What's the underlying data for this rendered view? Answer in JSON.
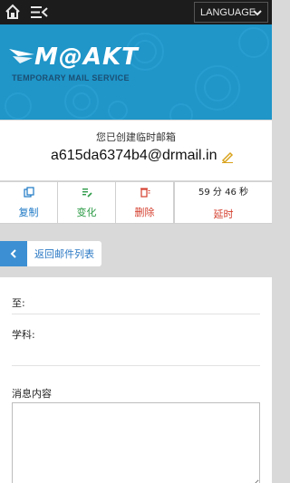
{
  "topbar": {
    "language_label": "LANGUAGE",
    "icons": [
      "home-icon",
      "menu-icon",
      "chevron-down-icon"
    ]
  },
  "header": {
    "logo_text": "M@AKT",
    "logo_subtitle": "TEMPORARY MAIL SERVICE",
    "background_color": "#1f95c8"
  },
  "email_card": {
    "caption": "您已创建临时邮箱",
    "address": "a615da6374b4@drmail.in",
    "edit_icon": "pencil-icon"
  },
  "actions": {
    "copy_label": "复制",
    "change_label": "变化",
    "delete_label": "删除",
    "timer_text": "59 分 46 秒",
    "extend_label": "延时",
    "colors": {
      "copy": "#1b77c5",
      "change": "#2d9b47",
      "delete": "#d43d2c"
    }
  },
  "back": {
    "label": "返回邮件列表",
    "icon": "chevron-left-icon"
  },
  "form": {
    "to_label": "至:",
    "to_value": "",
    "subject_label": "学科:",
    "subject_value": "",
    "message_label": "消息内容",
    "message_value": ""
  }
}
